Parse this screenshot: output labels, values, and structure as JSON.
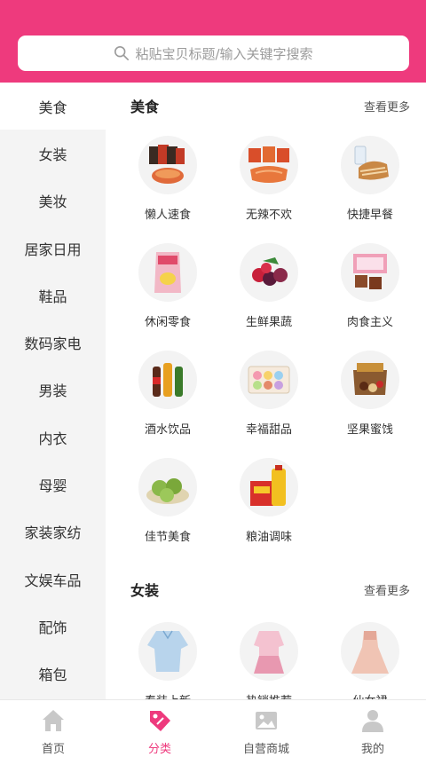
{
  "search": {
    "placeholder": "粘贴宝贝标题/输入关键字搜索"
  },
  "sidebar": {
    "items": [
      {
        "label": "美食",
        "active": true
      },
      {
        "label": "女装"
      },
      {
        "label": "美妆"
      },
      {
        "label": "居家日用"
      },
      {
        "label": "鞋品"
      },
      {
        "label": "数码家电"
      },
      {
        "label": "男装"
      },
      {
        "label": "内衣"
      },
      {
        "label": "母婴"
      },
      {
        "label": "家装家纺"
      },
      {
        "label": "文娱车品"
      },
      {
        "label": "配饰"
      },
      {
        "label": "箱包"
      }
    ]
  },
  "sections": [
    {
      "title": "美食",
      "more": "查看更多",
      "items": [
        {
          "label": "懒人速食",
          "icon": "instant-noodles-icon"
        },
        {
          "label": "无辣不欢",
          "icon": "spicy-snack-icon"
        },
        {
          "label": "快捷早餐",
          "icon": "bread-icon"
        },
        {
          "label": "休闲零食",
          "icon": "chips-icon"
        },
        {
          "label": "生鲜果蔬",
          "icon": "berries-icon"
        },
        {
          "label": "肉食主义",
          "icon": "meat-icon"
        },
        {
          "label": "酒水饮品",
          "icon": "drinks-icon"
        },
        {
          "label": "幸福甜品",
          "icon": "macaron-icon"
        },
        {
          "label": "坚果蜜饯",
          "icon": "nuts-icon"
        },
        {
          "label": "佳节美食",
          "icon": "dumplings-icon"
        },
        {
          "label": "粮油调味",
          "icon": "oil-rice-icon"
        }
      ]
    },
    {
      "title": "女装",
      "more": "查看更多",
      "items": [
        {
          "label": "春装上新",
          "icon": "blouse-icon"
        },
        {
          "label": "热销推荐",
          "icon": "pink-outfit-icon"
        },
        {
          "label": "仙女裙",
          "icon": "dress-icon"
        }
      ]
    }
  ],
  "bottom_nav": [
    {
      "label": "首页",
      "icon": "home-icon"
    },
    {
      "label": "分类",
      "icon": "category-tag-icon",
      "active": true
    },
    {
      "label": "自营商城",
      "icon": "image-mall-icon"
    },
    {
      "label": "我的",
      "icon": "user-icon"
    }
  ],
  "colors": {
    "brand": "#ee3a7d",
    "sidebar_bg": "#f4f4f4"
  }
}
